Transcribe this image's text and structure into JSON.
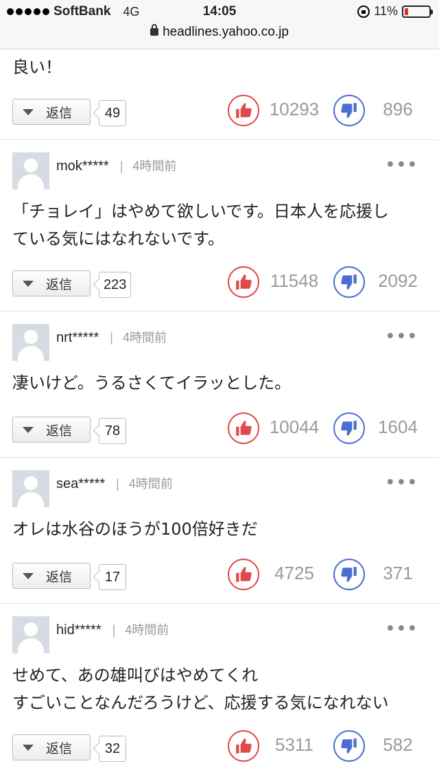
{
  "status": {
    "carrier": "SoftBank",
    "network": "4G",
    "time": "14:05",
    "battery": "11%",
    "url": "headlines.yahoo.co.jp"
  },
  "labels": {
    "reply": "返信"
  },
  "first": {
    "text": "良い！",
    "replies": "49",
    "likes": "10293",
    "dislikes": "896"
  },
  "comments": [
    {
      "user": "mok*****",
      "time": "4時間前",
      "lines": [
        "「チョレイ」はやめて欲しいです。日本人を応援し",
        "ている気にはなれないです。"
      ],
      "replies": "223",
      "likes": "11548",
      "dislikes": "2092"
    },
    {
      "user": "nrt*****",
      "time": "4時間前",
      "lines": [
        "凄いけど。うるさくてイラッとした。"
      ],
      "replies": "78",
      "likes": "10044",
      "dislikes": "1604"
    },
    {
      "user": "sea*****",
      "time": "4時間前",
      "lines": [
        "オレは水谷のほうが100倍好きだ"
      ],
      "replies": "17",
      "likes": "4725",
      "dislikes": "371"
    },
    {
      "user": "hid*****",
      "time": "4時間前",
      "lines": [
        "せめて、あの雄叫びはやめてくれ",
        "すごいことなんだろうけど、応援する気になれない"
      ],
      "replies": "32",
      "likes": "5311",
      "dislikes": "582"
    }
  ]
}
